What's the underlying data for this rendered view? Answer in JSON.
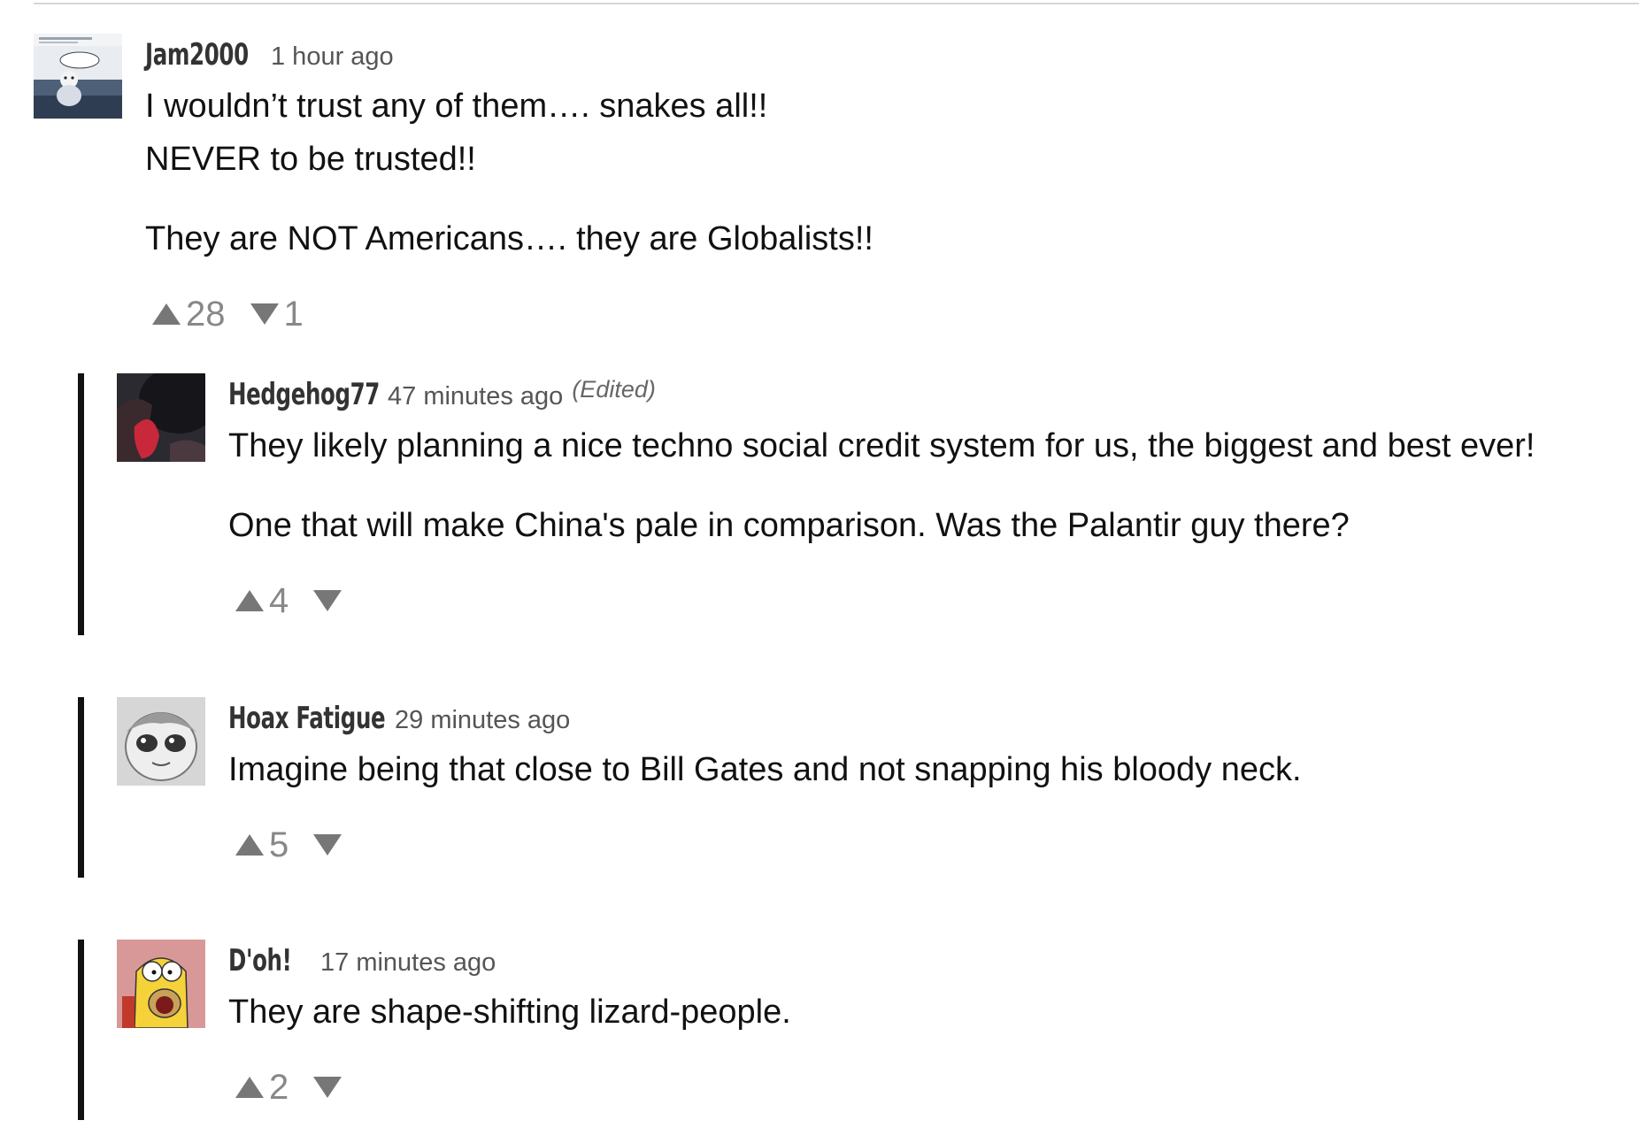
{
  "comments": [
    {
      "author": "Jam2000",
      "time": "1 hour ago",
      "edited": "",
      "lines": [
        "I wouldn’t trust any of them…. snakes all!!",
        "NEVER to be trusted!!",
        "They are NOT Americans…. they are Globalists!!"
      ],
      "upvotes": "28",
      "downvotes": "1"
    }
  ],
  "replies": [
    {
      "author": "Hedgehog77",
      "time": "47 minutes ago",
      "edited": "(Edited)",
      "lines": [
        "They likely planning a nice techno social credit system for us, the biggest and best ever!",
        "One that will make China's pale in comparison.  Was the Palantir guy there?"
      ],
      "upvotes": "4",
      "downvotes": ""
    },
    {
      "author": "Hoax Fatigue",
      "time": "29 minutes ago",
      "edited": "",
      "lines": [
        "Imagine being that close to Bill Gates and not snapping his bloody neck."
      ],
      "upvotes": "5",
      "downvotes": ""
    },
    {
      "author": "D'oh!",
      "time": "17 minutes ago",
      "edited": "",
      "lines": [
        "They are shape-shifting lizard-people."
      ],
      "upvotes": "2",
      "downvotes": ""
    }
  ],
  "icons": {
    "upvote": "triangle-up-icon",
    "downvote": "triangle-down-icon"
  },
  "colors": {
    "thread_bar": "#111111",
    "vote_gray": "#777777",
    "meta_gray": "#555555"
  }
}
